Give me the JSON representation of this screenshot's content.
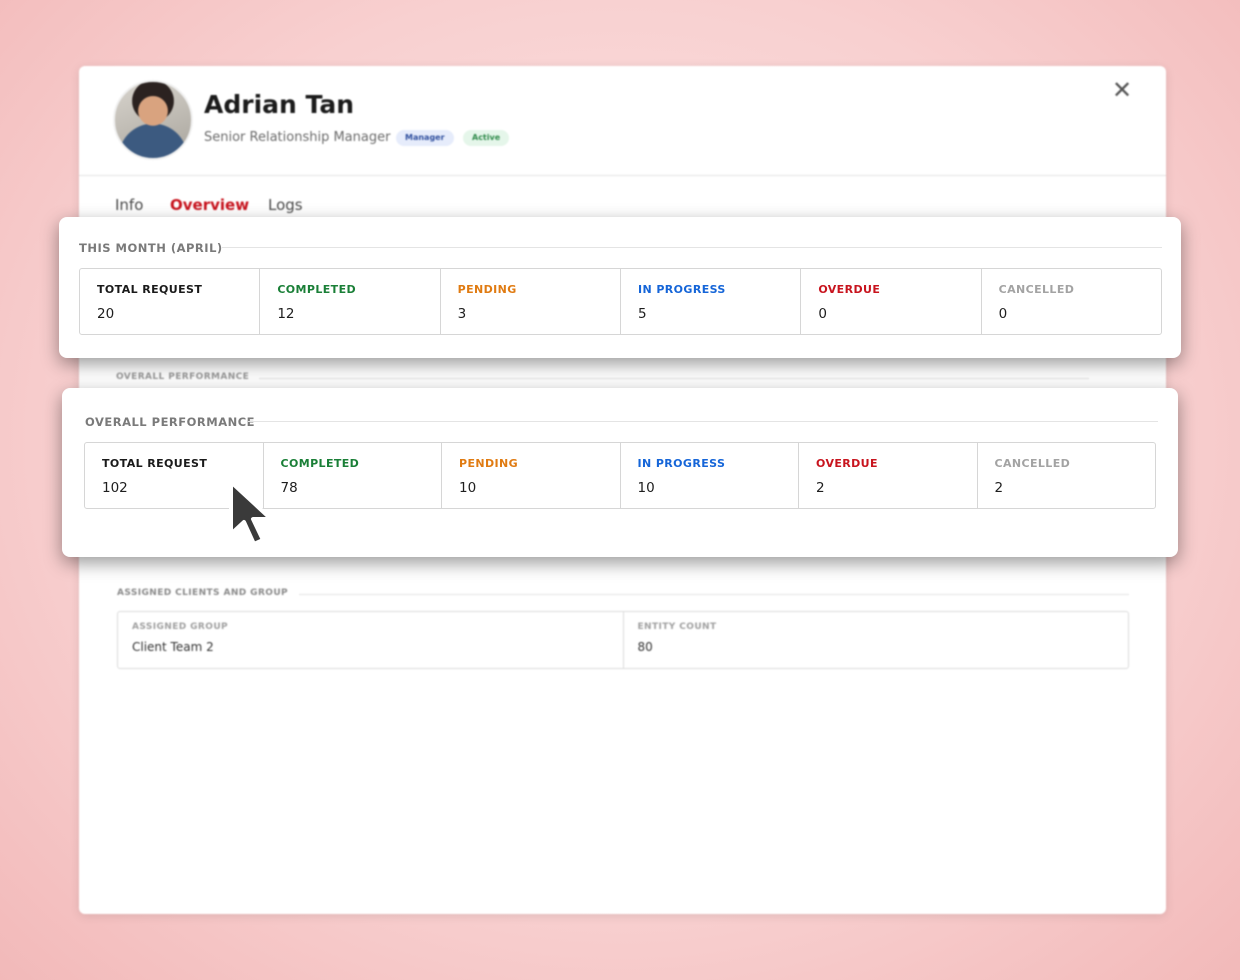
{
  "profile": {
    "name": "Adrian Tan",
    "role": "Senior Relationship Manager",
    "badges": {
      "manager": "Manager",
      "active": "Active"
    }
  },
  "tabs": [
    {
      "label": "Info",
      "active": false
    },
    {
      "label": "Overview",
      "active": true
    },
    {
      "label": "Logs",
      "active": false
    }
  ],
  "icons": {
    "close": "close-icon",
    "cursor": "cursor-arrow-icon",
    "avatar": "avatar-photo"
  },
  "colors": {
    "accent": "#c8141e",
    "total": "#1a1a1a",
    "completed": "#1a7f37",
    "pending": "#e07b12",
    "in_progress": "#1565d8",
    "overdue": "#c8141e",
    "cancelled": "#a3a3a3"
  },
  "this_month": {
    "title": "THIS MONTH (APRIL)",
    "stats": [
      {
        "label": "TOTAL REQUEST",
        "value": "20"
      },
      {
        "label": "COMPLETED",
        "value": "12"
      },
      {
        "label": "PENDING",
        "value": "3"
      },
      {
        "label": "IN PROGRESS",
        "value": "5"
      },
      {
        "label": "OVERDUE",
        "value": "0"
      },
      {
        "label": "CANCELLED",
        "value": "0"
      }
    ]
  },
  "overall": {
    "title": "OVERALL PERFORMANCE",
    "stats": [
      {
        "label": "TOTAL REQUEST",
        "value": "102"
      },
      {
        "label": "COMPLETED",
        "value": "78"
      },
      {
        "label": "PENDING",
        "value": "10"
      },
      {
        "label": "IN PROGRESS",
        "value": "10"
      },
      {
        "label": "OVERDUE",
        "value": "2"
      },
      {
        "label": "CANCELLED",
        "value": "2"
      }
    ]
  },
  "assigned": {
    "title": "ASSIGNED CLIENTS AND GROUP",
    "group_label": "ASSIGNED GROUP",
    "group_value": "Client Team 2",
    "entity_label": "ENTITY COUNT",
    "entity_value": "80"
  }
}
